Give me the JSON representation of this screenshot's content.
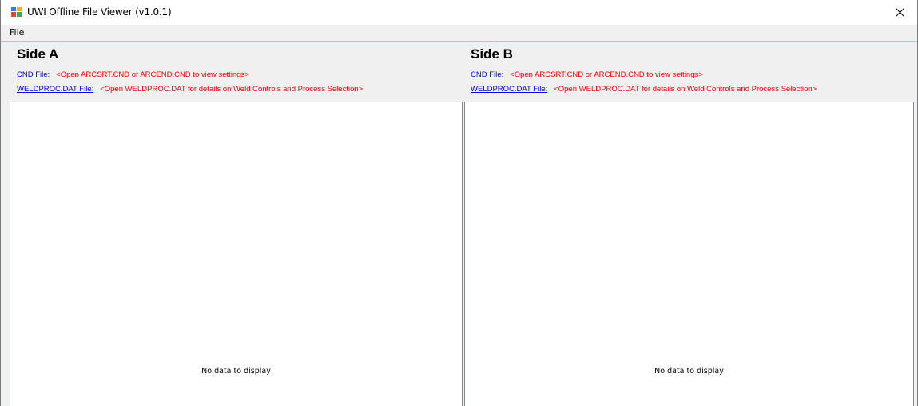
{
  "window": {
    "title": "UWI Offline File Viewer (v1.0.1)",
    "close_icon": "close-icon",
    "app_icon": "app-icon"
  },
  "menu": {
    "file_label": "File"
  },
  "side_a": {
    "title": "Side A",
    "cnd_link": "CND File:",
    "cnd_message": "<Open ARCSRT.CND or ARCEND.CND to view settings>",
    "weldproc_link": "WELDPROC.DAT File:",
    "weldproc_message": "<Open WELDPROC.DAT for details on Weld Controls and Process Selection>",
    "empty_text": "No data to display"
  },
  "side_b": {
    "title": "Side B",
    "cnd_link": "CND File:",
    "cnd_message": "<Open ARCSRT.CND or ARCEND.CND to view settings>",
    "weldproc_link": "WELDPROC.DAT File:",
    "weldproc_message": "<Open WELDPROC.DAT for details on Weld Controls and Process Selection>",
    "empty_text": "No data to display"
  },
  "colors": {
    "link": "#0000ee",
    "message": "#ff0000",
    "chrome": "#f0f0f0"
  }
}
